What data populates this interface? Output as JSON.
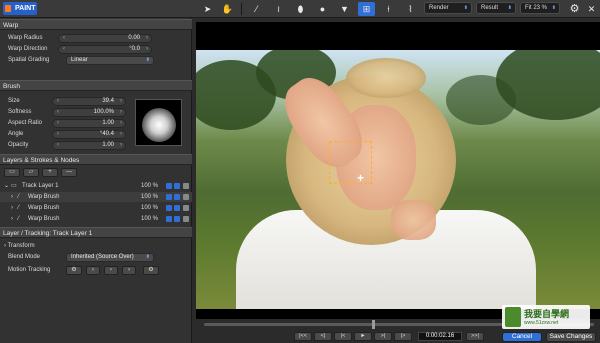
{
  "app": {
    "logo_text": "PAINT"
  },
  "toolbar": {
    "tools": [
      {
        "icon": "arrow-pointer-icon",
        "glyph": "➤"
      },
      {
        "icon": "hand-icon",
        "glyph": "✋"
      },
      {
        "icon": "brush-icon",
        "glyph": "⁄"
      },
      {
        "icon": "smudge-icon",
        "glyph": "≀"
      },
      {
        "icon": "dropper-icon",
        "glyph": "⬮"
      },
      {
        "icon": "blob-icon",
        "glyph": "●"
      },
      {
        "icon": "fill-icon",
        "glyph": "▼"
      },
      {
        "icon": "grid-icon",
        "glyph": "⊞"
      },
      {
        "icon": "puppet-icon",
        "glyph": "⍿"
      },
      {
        "icon": "pin-icon",
        "glyph": "⌇"
      }
    ],
    "selected_tool_index": 7,
    "view_select": "Render",
    "view_mode_select": "Result",
    "zoom_select": "Fit 23 %"
  },
  "warp": {
    "title": "Warp",
    "radius_label": "Warp Radius",
    "radius_value": "0.00",
    "direction_label": "Warp Direction",
    "direction_value": "°0.0",
    "grading_label": "Spatial Grading",
    "grading_value": "Linear"
  },
  "brush": {
    "title": "Brush",
    "size_label": "Size",
    "size_value": "39.4",
    "softness_label": "Softness",
    "softness_value": "100.0%",
    "aspect_label": "Aspect Ratio",
    "aspect_value": "1.00",
    "angle_label": "Angle",
    "angle_value": "°40.4",
    "opacity_label": "Opacity",
    "opacity_value": "1.00"
  },
  "layers": {
    "title": "Layers & Strokes & Nodes",
    "add_button": "+",
    "remove_button": "—",
    "track_layer": {
      "name": "Track Layer 1",
      "opacity": "100 %"
    },
    "strokes": [
      {
        "name": "Warp Brush",
        "opacity": "100 %"
      },
      {
        "name": "Warp Brush",
        "opacity": "100 %"
      },
      {
        "name": "Warp Brush",
        "opacity": "100 %"
      }
    ]
  },
  "tracking": {
    "title": "Layer / Tracking: Track Layer 1",
    "transform_label": "Transform",
    "blend_label": "Blend Mode",
    "blend_value": "Inherited (Source Over)",
    "motion_label": "Motion Tracking"
  },
  "playback": {
    "timecode": "0:00:02.16",
    "buttons": [
      "|<<",
      "<|",
      "|<",
      "►",
      ">|",
      "|>",
      ">>|"
    ]
  },
  "footer": {
    "cancel_label": "Cancel",
    "save_label": "Save Changes"
  },
  "watermark": {
    "title": "我要自學網",
    "url": "www.51zxw.net"
  },
  "colors": {
    "accent": "#2f6fd6",
    "warp_box": "#ffae2a",
    "logo_mark": "#ff7a1a"
  }
}
